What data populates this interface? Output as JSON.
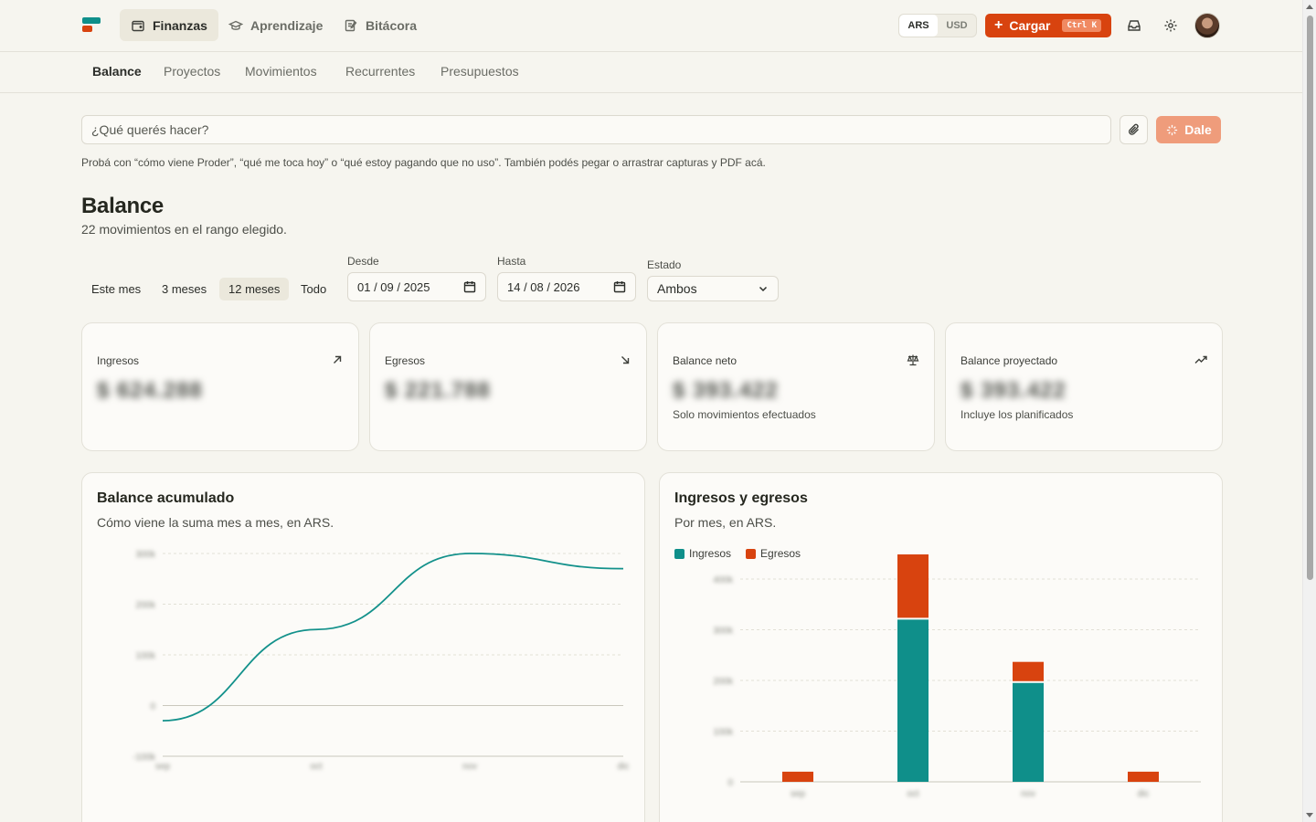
{
  "nav": {
    "tabs": [
      {
        "label": "Finanzas",
        "icon": "wallet-icon",
        "active": true
      },
      {
        "label": "Aprendizaje",
        "icon": "graduation-cap-icon",
        "active": false
      },
      {
        "label": "Bitácora",
        "icon": "journal-edit-icon",
        "active": false
      }
    ],
    "currency": {
      "options": [
        "ARS",
        "USD"
      ],
      "selected": "ARS"
    },
    "cargar": {
      "label": "Cargar",
      "shortcut": "Ctrl K"
    },
    "icons": [
      "inbox-icon",
      "gear-icon"
    ]
  },
  "subnav": {
    "items": [
      "Balance",
      "Proyectos",
      "Movimientos",
      "Recurrentes",
      "Presupuestos"
    ],
    "active": "Balance"
  },
  "prompt": {
    "placeholder": "¿Qué querés hacer?",
    "submit_label": "Dale",
    "hint": "Probá con “cómo viene Proder”, “qué me toca hoy” o “qué estoy pagando que no uso”. También podés pegar o arrastrar capturas y PDF acá."
  },
  "header": {
    "title": "Balance",
    "subtitle": "22 movimientos en el rango elegido."
  },
  "filters": {
    "ranges": [
      "Este mes",
      "3 meses",
      "12 meses",
      "Todo"
    ],
    "active_range": "12 meses",
    "desde_label": "Desde",
    "desde_value": "01 / 09 / 2025",
    "hasta_label": "Hasta",
    "hasta_value": "14 / 08 / 2026",
    "estado_label": "Estado",
    "estado_value": "Ambos"
  },
  "cards": [
    {
      "label": "Ingresos",
      "value": "$ 624.288",
      "note": "",
      "icon": "arrow-up-right-icon"
    },
    {
      "label": "Egresos",
      "value": "$ 221.788",
      "note": "",
      "icon": "arrow-down-right-icon"
    },
    {
      "label": "Balance neto",
      "value": "$ 393.422",
      "note": "Solo movimientos efectuados",
      "icon": "scale-icon"
    },
    {
      "label": "Balance proyectado",
      "value": "$ 393.422",
      "note": "Incluye los planificados",
      "icon": "trending-up-icon"
    }
  ],
  "panels": {
    "balance": {
      "title": "Balance acumulado",
      "subtitle": "Cómo viene la suma mes a mes, en ARS."
    },
    "ingresos_egresos": {
      "title": "Ingresos y egresos",
      "subtitle": "Por mes, en ARS.",
      "legend": [
        "Ingresos",
        "Egresos"
      ]
    }
  },
  "chart_data": [
    {
      "type": "line",
      "title": "Balance acumulado",
      "x": [
        "sep",
        "oct",
        "nov",
        "dic"
      ],
      "series": [
        {
          "values": [
            -30000,
            150000,
            300000,
            270000
          ]
        }
      ],
      "ylim": [
        -100000,
        300000
      ],
      "yticks": [
        "300k",
        "200k",
        "100k",
        "0",
        "-100k"
      ],
      "color": "#13918b",
      "grid": true
    },
    {
      "type": "bar",
      "title": "Ingresos y egresos",
      "categories": [
        "sep",
        "oct",
        "nov",
        "dic"
      ],
      "stacked": true,
      "series": [
        {
          "name": "Ingresos",
          "values": [
            0,
            320000,
            195000,
            0
          ],
          "color": "#0f8f8a"
        },
        {
          "name": "Egresos",
          "values": [
            20000,
            125000,
            38000,
            20000
          ],
          "color": "#d8430f"
        }
      ],
      "ylim": [
        0,
        400000
      ],
      "yticks": [
        "400k",
        "300k",
        "200k",
        "100k",
        "0"
      ],
      "legend": "top-left",
      "grid": true
    }
  ]
}
